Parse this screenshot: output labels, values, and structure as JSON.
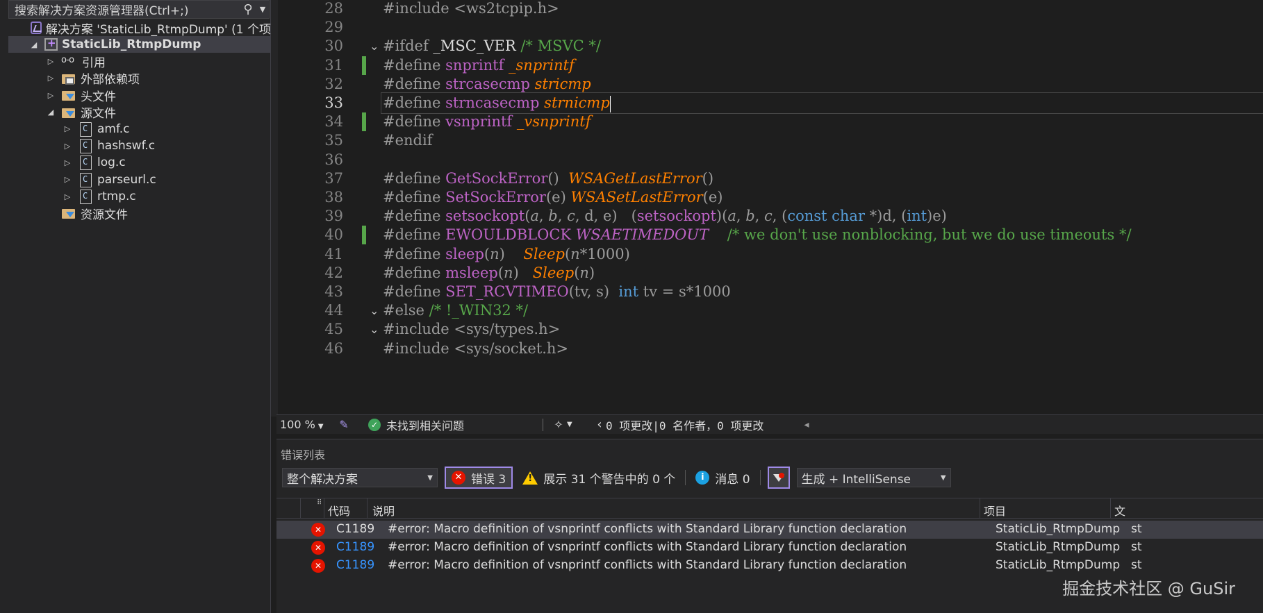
{
  "solution_explorer": {
    "search_placeholder": "搜索解决方案资源管理器(Ctrl+;)",
    "tree": [
      {
        "label": "解决方案 'StaticLib_RtmpDump' (1 个项",
        "icon": "solution-icon",
        "expander": ""
      },
      {
        "label": "StaticLib_RtmpDump",
        "icon": "cpp-project-icon",
        "expander": "◢"
      },
      {
        "label": "引用",
        "icon": "references-icon",
        "expander": "▷"
      },
      {
        "label": "外部依赖项",
        "icon": "external-deps-folder-icon",
        "expander": "▷"
      },
      {
        "label": "头文件",
        "icon": "filter-folder-icon",
        "expander": "▷"
      },
      {
        "label": "源文件",
        "icon": "filter-folder-icon",
        "expander": "◢"
      },
      {
        "label": "amf.c",
        "icon": "c-file-icon",
        "expander": "▷"
      },
      {
        "label": "hashswf.c",
        "icon": "c-file-icon",
        "expander": "▷"
      },
      {
        "label": "log.c",
        "icon": "c-file-icon",
        "expander": "▷"
      },
      {
        "label": "parseurl.c",
        "icon": "c-file-icon",
        "expander": "▷"
      },
      {
        "label": "rtmp.c",
        "icon": "c-file-icon",
        "expander": "▷"
      },
      {
        "label": "资源文件",
        "icon": "filter-folder-icon",
        "expander": ""
      }
    ]
  },
  "editor": {
    "current_line": "33",
    "lines": [
      {
        "n": "28",
        "fold": "",
        "bar": false,
        "t": [
          [
            "#include ",
            "pre"
          ],
          [
            "<ws2tcpip.h>",
            "str"
          ]
        ]
      },
      {
        "n": "29",
        "fold": "",
        "bar": false,
        "t": []
      },
      {
        "n": "30",
        "fold": "⌄",
        "bar": false,
        "t": [
          [
            "#ifdef ",
            "pre"
          ],
          [
            "_MSC_VER ",
            "plain"
          ],
          [
            "/* MSVC */",
            "cm"
          ]
        ]
      },
      {
        "n": "31",
        "fold": "",
        "bar": true,
        "t": [
          [
            "#define ",
            "pre"
          ],
          [
            "snprintf ",
            "mac"
          ],
          [
            "_snprintf",
            "fn"
          ]
        ]
      },
      {
        "n": "32",
        "fold": "",
        "bar": false,
        "t": [
          [
            "#define ",
            "pre"
          ],
          [
            "strcasecmp ",
            "mac"
          ],
          [
            "stricmp",
            "fn"
          ]
        ]
      },
      {
        "n": "33",
        "fold": "",
        "bar": false,
        "t": [
          [
            "#define ",
            "pre"
          ],
          [
            "strncasecmp ",
            "mac"
          ],
          [
            "strnicmp",
            "fn"
          ]
        ]
      },
      {
        "n": "34",
        "fold": "",
        "bar": true,
        "t": [
          [
            "#define ",
            "pre"
          ],
          [
            "vsnprintf ",
            "mac"
          ],
          [
            "_vsnprintf",
            "fn"
          ]
        ]
      },
      {
        "n": "35",
        "fold": "",
        "bar": false,
        "t": [
          [
            "#endif",
            "pre"
          ]
        ]
      },
      {
        "n": "36",
        "fold": "",
        "bar": false,
        "t": []
      },
      {
        "n": "37",
        "fold": "",
        "bar": false,
        "t": [
          [
            "#define ",
            "pre"
          ],
          [
            "GetSockError",
            "mac"
          ],
          [
            "()  ",
            "pre"
          ],
          [
            "WSAGetLastError",
            "fn"
          ],
          [
            "()",
            "pre"
          ]
        ]
      },
      {
        "n": "38",
        "fold": "",
        "bar": false,
        "t": [
          [
            "#define ",
            "pre"
          ],
          [
            "SetSockError",
            "mac"
          ],
          [
            "(e) ",
            "pre"
          ],
          [
            "WSASetLastError",
            "fn"
          ],
          [
            "(e)",
            "pre"
          ]
        ]
      },
      {
        "n": "39",
        "fold": "",
        "bar": false,
        "t": [
          [
            "#define ",
            "pre"
          ],
          [
            "setsockopt",
            "mac"
          ],
          [
            "(",
            "pre"
          ],
          [
            "a",
            "prm"
          ],
          [
            ", ",
            "pre"
          ],
          [
            "b",
            "prm"
          ],
          [
            ", ",
            "pre"
          ],
          [
            "c",
            "prm"
          ],
          [
            ", d, e)   (",
            "pre"
          ],
          [
            "setsockopt",
            "mac"
          ],
          [
            ")(",
            "pre"
          ],
          [
            "a",
            "prm"
          ],
          [
            ", ",
            "pre"
          ],
          [
            "b",
            "prm"
          ],
          [
            ", ",
            "pre"
          ],
          [
            "c",
            "prm"
          ],
          [
            ", (",
            "pre"
          ],
          [
            "const char",
            "kw"
          ],
          [
            " *)d, (",
            "pre"
          ],
          [
            "int",
            "kw"
          ],
          [
            ")e)",
            "pre"
          ]
        ]
      },
      {
        "n": "40",
        "fold": "",
        "bar": true,
        "t": [
          [
            "#define ",
            "pre"
          ],
          [
            "EWOULDBLOCK ",
            "mac"
          ],
          [
            "WSAETIMEDOUT",
            "mac-i"
          ],
          [
            "    /* we don't use nonblocking, but we do use timeouts */",
            "cm"
          ]
        ]
      },
      {
        "n": "41",
        "fold": "",
        "bar": false,
        "t": [
          [
            "#define ",
            "pre"
          ],
          [
            "sleep",
            "mac"
          ],
          [
            "(",
            "pre"
          ],
          [
            "n",
            "prm"
          ],
          [
            ")    ",
            "pre"
          ],
          [
            "Sleep",
            "fn"
          ],
          [
            "(",
            "pre"
          ],
          [
            "n",
            "prm"
          ],
          [
            "*1000)",
            "pre"
          ]
        ]
      },
      {
        "n": "42",
        "fold": "",
        "bar": false,
        "t": [
          [
            "#define ",
            "pre"
          ],
          [
            "msleep",
            "mac"
          ],
          [
            "(",
            "pre"
          ],
          [
            "n",
            "prm"
          ],
          [
            ")   ",
            "pre"
          ],
          [
            "Sleep",
            "fn"
          ],
          [
            "(",
            "pre"
          ],
          [
            "n",
            "prm"
          ],
          [
            ")",
            "pre"
          ]
        ]
      },
      {
        "n": "43",
        "fold": "",
        "bar": false,
        "t": [
          [
            "#define ",
            "pre"
          ],
          [
            "SET_RCVTIMEO",
            "mac"
          ],
          [
            "(tv, s)  ",
            "pre"
          ],
          [
            "int",
            "kw"
          ],
          [
            " tv = s*1000",
            "pre"
          ]
        ]
      },
      {
        "n": "44",
        "fold": "⌄",
        "bar": false,
        "t": [
          [
            "#else ",
            "pre"
          ],
          [
            "/* !_WIN32 */",
            "cm"
          ]
        ]
      },
      {
        "n": "45",
        "fold": "⌄",
        "bar": false,
        "t": [
          [
            "#include ",
            "pre"
          ],
          [
            "<sys/types.h>",
            "str"
          ]
        ]
      },
      {
        "n": "46",
        "fold": "",
        "bar": false,
        "t": [
          [
            "#include ",
            "pre"
          ],
          [
            "<sys/socket.h>",
            "str"
          ]
        ]
      }
    ]
  },
  "status_bar": {
    "zoom": "100 %",
    "issues": "未找到相关问题",
    "changes": "0 项更改|0 名作者，0 项更改"
  },
  "error_list": {
    "title": "错误列表",
    "scope": "整个解决方案",
    "errors_label": "错误 3",
    "warnings_label": "展示 31 个警告中的 0 个",
    "messages_label": "消息 0",
    "build_filter": "生成 + IntelliSense",
    "columns": {
      "code": "代码",
      "description": "说明",
      "project": "项目",
      "file": "文"
    },
    "rows": [
      {
        "code": "C1189",
        "description": "#error:  Macro definition of vsnprintf conflicts with Standard Library function declaration",
        "project": "StaticLib_RtmpDump",
        "file": "st"
      },
      {
        "code": "C1189",
        "description": "#error:  Macro definition of vsnprintf conflicts with Standard Library function declaration",
        "project": "StaticLib_RtmpDump",
        "file": "st"
      },
      {
        "code": "C1189",
        "description": "#error:  Macro definition of vsnprintf conflicts with Standard Library function declaration",
        "project": "StaticLib_RtmpDump",
        "file": "st"
      }
    ]
  },
  "watermark": "掘金技术社区 @ GuSir"
}
